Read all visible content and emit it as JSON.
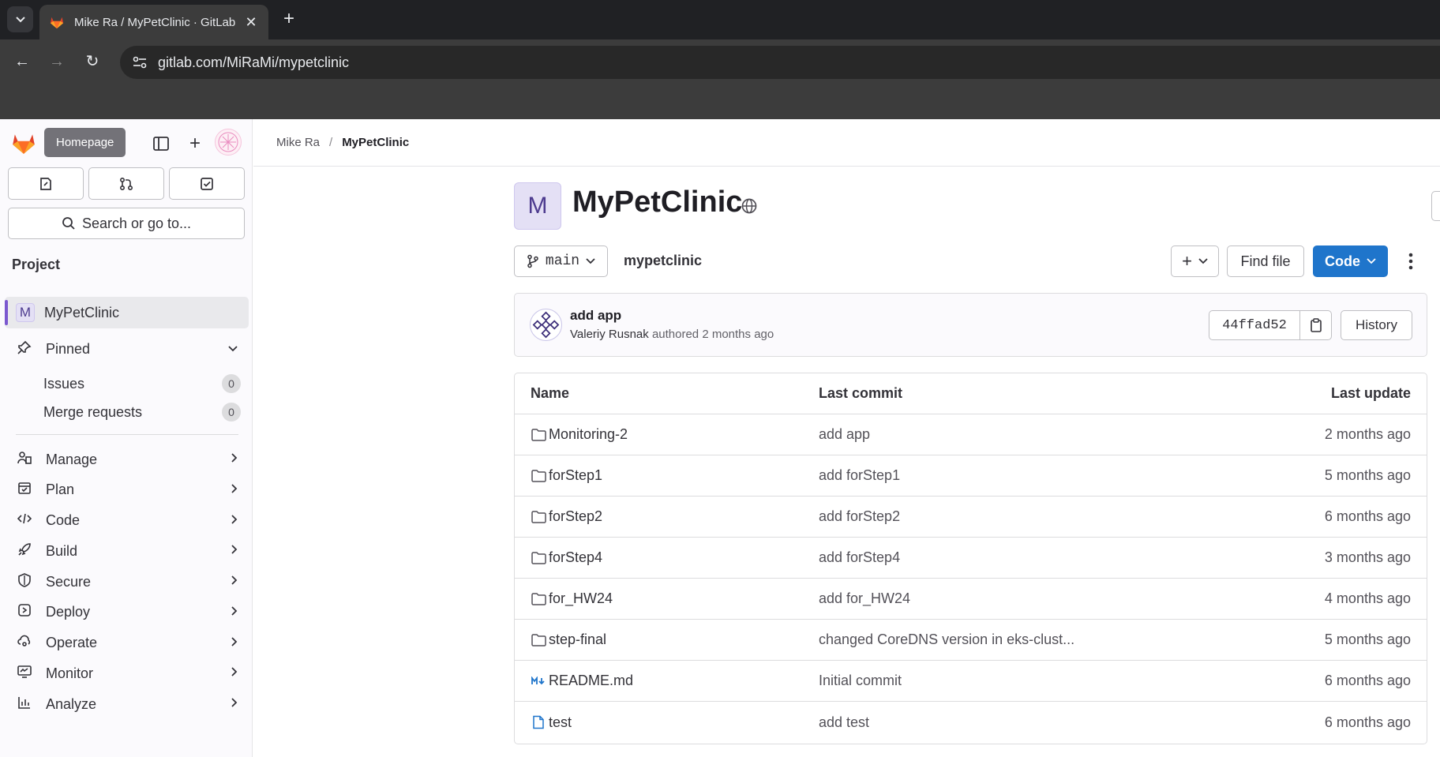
{
  "browser": {
    "tab_title": "Mike Ra / MyPetClinic · GitLab",
    "tab_close": "✕",
    "new_tab": "+",
    "url": "gitlab.com/MiRaMi/mypetclinic"
  },
  "sidebar": {
    "tooltip": "Homepage",
    "search_label": "Search or go to...",
    "section_title": "Project",
    "project_name": "MyPetClinic",
    "project_initial": "M",
    "pinned_label": "Pinned",
    "pinned_items": [
      {
        "label": "Issues",
        "count": "0"
      },
      {
        "label": "Merge requests",
        "count": "0"
      }
    ],
    "nav": [
      {
        "label": "Manage",
        "icon": "users-icon"
      },
      {
        "label": "Plan",
        "icon": "calendar-icon"
      },
      {
        "label": "Code",
        "icon": "code-icon"
      },
      {
        "label": "Build",
        "icon": "rocket-icon"
      },
      {
        "label": "Secure",
        "icon": "shield-icon"
      },
      {
        "label": "Deploy",
        "icon": "deploy-icon"
      },
      {
        "label": "Operate",
        "icon": "cloud-gear-icon"
      },
      {
        "label": "Monitor",
        "icon": "monitor-icon"
      },
      {
        "label": "Analyze",
        "icon": "chart-icon"
      }
    ]
  },
  "breadcrumb": {
    "owner": "Mike Ra",
    "separator": "/",
    "project": "MyPetClinic"
  },
  "project": {
    "initial": "M",
    "title": "MyPetClinic"
  },
  "repo": {
    "branch": "main",
    "path": "mypetclinic",
    "add_symbol": "+",
    "find_file": "Find file",
    "code_label": "Code"
  },
  "commit": {
    "title": "add app",
    "author": "Valeriy Rusnak",
    "action": "authored 2 months ago",
    "sha": "44ffad52",
    "history_label": "History"
  },
  "files": {
    "headers": {
      "name": "Name",
      "last_commit": "Last commit",
      "last_update": "Last update"
    },
    "rows": [
      {
        "name": "Monitoring-2",
        "type": "folder",
        "commit": "add app",
        "updated": "2 months ago"
      },
      {
        "name": "forStep1",
        "type": "folder",
        "commit": "add forStep1",
        "updated": "5 months ago"
      },
      {
        "name": "forStep2",
        "type": "folder",
        "commit": "add forStep2",
        "updated": "6 months ago"
      },
      {
        "name": "forStep4",
        "type": "folder",
        "commit": "add forStep4",
        "updated": "3 months ago"
      },
      {
        "name": "for_HW24",
        "type": "folder",
        "commit": "add for_HW24",
        "updated": "4 months ago"
      },
      {
        "name": "step-final",
        "type": "folder",
        "commit": "changed CoreDNS version in eks-clust...",
        "updated": "5 months ago"
      },
      {
        "name": "README.md",
        "type": "markdown",
        "commit": "Initial commit",
        "updated": "6 months ago"
      },
      {
        "name": "test",
        "type": "file",
        "commit": "add test",
        "updated": "6 months ago"
      }
    ]
  },
  "colors": {
    "brand_blue": "#1f75cb",
    "active_bar": "#7b58cf",
    "sidebar_bg": "#fbfafd"
  }
}
